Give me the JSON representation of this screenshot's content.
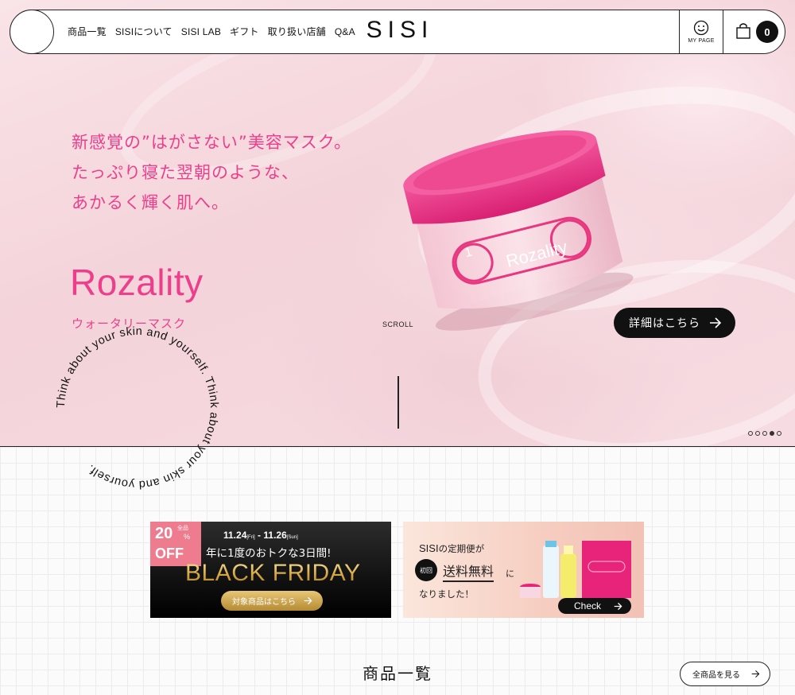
{
  "header": {
    "nav": [
      "商品一覧",
      "SISIについて",
      "SISI LAB",
      "ギフト",
      "取り扱い店舗",
      "Q&A"
    ],
    "brand": "SISI",
    "mypage_label": "MY PAGE",
    "cart_count": "0"
  },
  "hero": {
    "copy": [
      "新感覚の”はがさない”美容マスク。",
      "たっぷり寝た翌朝のような、",
      "あかるく輝く肌へ。"
    ],
    "product_name": "Rozality",
    "product_sub": "ウォータリーマスク",
    "jar_number": "1",
    "jar_label": "Rozality",
    "circle_text": "Think about your skin and yourself.  Think about your skin and yourself.",
    "scroll_label": "SCROLL",
    "detail_button": "詳細はこちら",
    "slides_total": 5,
    "slide_active": 4
  },
  "banners": {
    "black_friday": {
      "badge_top": "20",
      "badge_percent": "%",
      "badge_mini": "全品",
      "badge_bottom": "OFF",
      "date_start": "11.24",
      "date_start_day": "[Fri]",
      "date_sep": " - ",
      "date_end": "11.26",
      "date_end_day": "[Sun]",
      "line": "年に1度のおトクな3日間!",
      "title": "BLACK FRIDAY",
      "button": "対象商品はこちら"
    },
    "subscription": {
      "line1_brand": "SISI",
      "line1_rest": "の定期便が",
      "badge": "初回",
      "free": "送料無料",
      "ni": "に",
      "line3": "なりました！",
      "button": "Check"
    }
  },
  "products": {
    "section_title": "商品一覧",
    "all_button": "全商品を見る"
  },
  "colors": {
    "accent_pink": "#ee3e8b",
    "black": "#111111",
    "gold": "#d7a640"
  }
}
